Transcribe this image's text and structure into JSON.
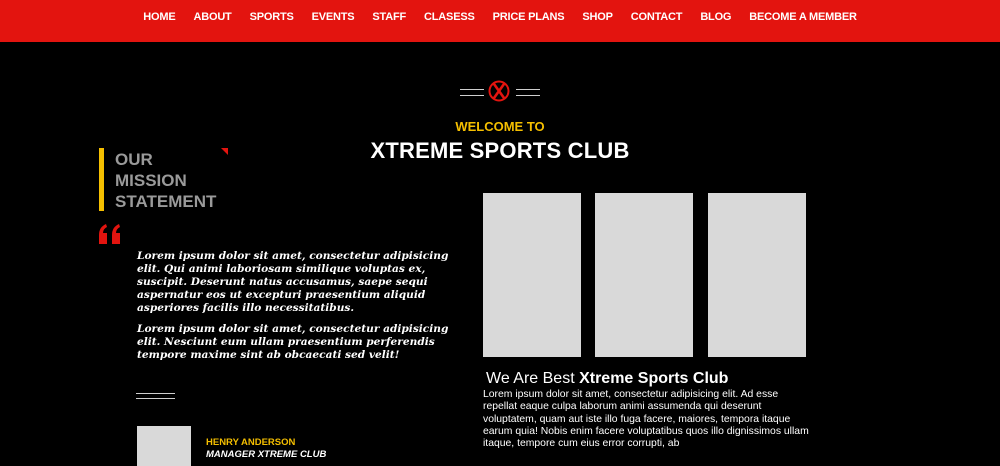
{
  "nav": {
    "items": [
      "HOME",
      "ABOUT",
      "SPORTS",
      "EVENTS",
      "STAFF",
      "CLASESS",
      "PRICE PLANS",
      "SHOP",
      "CONTACT",
      "BLOG",
      "BECOME A MEMBER"
    ]
  },
  "hero": {
    "logo_icon": "x-circle-logo-icon",
    "welcome": "WELCOME TO",
    "club_name": "XTREME SPORTS CLUB"
  },
  "mission": {
    "title_line1": "OUR",
    "title_line2": "MISSION",
    "title_line3": "STATEMENT",
    "quote_icon": "quote-icon",
    "paragraph1": "Lorem ipsum dolor sit amet, consectetur adipisicing elit. Qui animi laboriosam similique voluptas ex, suscipit. Deserunt natus accusamus, saepe sequi aspernatur eos ut excepturi praesentium aliquid asperiores facilis illo necessitatibus.",
    "paragraph2": "Lorem ipsum dolor sit amet, consectetur adipisicing elit. Nesciunt eum ullam praesentium perferendis tempore maxime sint ab obcaecati sed velit!",
    "author_name": "HENRY ANDERSON",
    "author_role": "MANAGER XTREME CLUB"
  },
  "about": {
    "title_prefix": "We Are Best ",
    "title_bold": "Xtreme Sports Club",
    "body": "Lorem ipsum dolor sit amet, consectetur adipisicing elit. Ad esse repellat eaque culpa laborum animi assumenda qui deserunt voluptatem, quam aut iste illo fuga facere, maiores, tempora itaque earum quia! Nobis enim facere voluptatibus quos illo dignissimos ullam itaque, tempore cum eius error corrupti, ab"
  },
  "colors": {
    "nav_bg": "#e3140f",
    "accent_yellow": "#f5bf00",
    "background": "#000000",
    "placeholder": "#d9d9d9"
  }
}
